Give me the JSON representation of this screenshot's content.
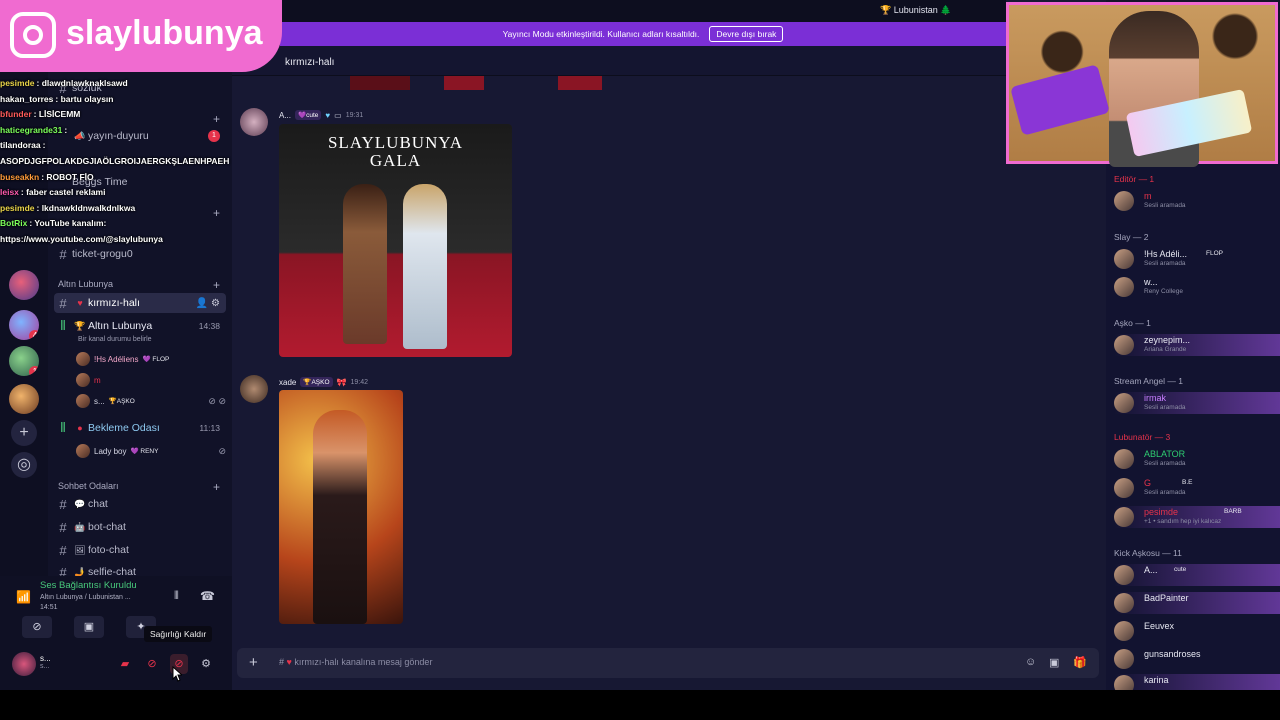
{
  "overlay": {
    "instagram_handle": "slaylubunya",
    "chat": [
      {
        "user": "pesimde",
        "color": "#e9d44a",
        "text": ": dlawdnlawknaklsawd"
      },
      {
        "user": "hakan_torres",
        "color": "#ffffff",
        "text": ": bartu olaysın"
      },
      {
        "user": "bfunder",
        "color": "#ff5b5b",
        "text": ": LİSİCEMM"
      },
      {
        "user": "haticegrande31",
        "color": "#7cff5b",
        "text": ":"
      },
      {
        "user": "tilandoraa",
        "color": "#ffffff",
        "text": ":"
      },
      {
        "user": "",
        "color": "#ffffff",
        "text": "ASOPDJGFPOLAKDGJIAÖLGROIJAERGKŞLAENHPAEH"
      },
      {
        "user": "buseakkn",
        "color": "#ff9b3a",
        "text": ": ROBOT FİO"
      },
      {
        "user": "leisx",
        "color": "#ff5bb0",
        "text": ": faber castel reklami"
      },
      {
        "user": "pesimde",
        "color": "#e9d44a",
        "text": ": lkdnawkldnwalkdnlkwa"
      },
      {
        "user": "BotRix",
        "color": "#7cff5b",
        "text": ": YouTube kanalım:"
      },
      {
        "user": "",
        "color": "#ffffff",
        "text": "https://www.youtube.com/@slaylubunya"
      }
    ]
  },
  "window": {
    "server_title": "Lubunistan",
    "notice_text": "Yayıncı Modu etkinleştirildi. Kullanıcı adları kısaltıldı.",
    "notice_button": "Devre dışı bırak"
  },
  "sidebar": {
    "partial_channels": [
      "sözlük",
      "yayın-duyuru",
      "Beggs Time",
      "ticket-grogu0"
    ],
    "cat_altin": "Altın Lubunya",
    "ch_kirmizi": "kırmızı-halı",
    "voice_altin": "Altın Lubunya",
    "voice_altin_time": "14:38",
    "voice_altin_note": "Bir kanal durumu belirle",
    "vu1_name": "!Hs Adéliens",
    "vu1_tag": "FLOP",
    "vu2_name": "m",
    "vu3_name": "s...",
    "vu3_tag": "AŞKO",
    "voice_bekleme": "Bekleme Odası",
    "voice_bekleme_time": "11:13",
    "vu4_name": "Lady boy",
    "vu4_tag": "RENY",
    "cat_sohbet": "Sohbet Odaları",
    "ch_chat": "chat",
    "ch_bot": "bot-chat",
    "ch_foto": "foto-chat",
    "ch_selfie": "selfie-chat",
    "badge_yayin": "1",
    "badge_s3": "4",
    "badge_s4": "1"
  },
  "voice_panel": {
    "status": "Ses Bağlantısı Kuruldu",
    "channel": "Altın Lubunya / Lubunistan ...",
    "time": "14:51",
    "user_name": "s...",
    "user_sub": "s...",
    "tooltip": "Sağırlığı Kaldır"
  },
  "chat": {
    "channel_name": "kırmızı-halı",
    "msg1_user": "A...",
    "msg1_badge": "cute",
    "msg1_time": "19:31",
    "msg1_image_caption": "SLAYLUBUNYA\nGALA",
    "msg2_user": "xade",
    "msg2_badge": "AŞKO",
    "msg2_time": "19:42",
    "composer_placeholder": "kırmızı-halı kanalına mesaj gönder"
  },
  "members": {
    "roles": [
      {
        "label": "Editör — 1",
        "color": "#e5334b"
      },
      {
        "label": "Slay — 2",
        "color": "#a5a6bd"
      },
      {
        "label": "Aşko — 1",
        "color": "#a5a6bd"
      },
      {
        "label": "Stream Angel — 1",
        "color": "#a5a6bd"
      },
      {
        "label": "Lubunatör — 3",
        "color": "#e5334b"
      },
      {
        "label": "Kick Aşkosu — 11",
        "color": "#a5a6bd"
      }
    ],
    "list": [
      {
        "name": "m",
        "status": "Sesli aramada",
        "color": "#e5334b"
      },
      {
        "name": "!Hs Adéli...",
        "status": "Sesli aramada",
        "color": "#e7e8f2",
        "tag": "FLOP"
      },
      {
        "name": "w...",
        "status": "Reny College",
        "color": "#e7e8f2"
      },
      {
        "name": "zeynepim...",
        "status": "Ariana Grande",
        "color": "#e7e8f2"
      },
      {
        "name": "irmak",
        "status": "Sesli aramada",
        "color": "#c77dff"
      },
      {
        "name": "ABLATOR",
        "status": "Sesli aramada",
        "color": "#2ecc71"
      },
      {
        "name": "G",
        "status": "Sesli aramada",
        "color": "#e5334b",
        "tag": "B.E"
      },
      {
        "name": "pesimde",
        "status": "+1 • sandım hep iyi kalıcaz",
        "color": "#e5334b",
        "tag": "BARB"
      },
      {
        "name": "A...",
        "status": "",
        "color": "#e7e8f2",
        "tag": "cute"
      },
      {
        "name": "BadPainter",
        "status": "",
        "color": "#e7e8f2"
      },
      {
        "name": "Eeuvex",
        "status": "",
        "color": "#e7e8f2"
      },
      {
        "name": "gunsandroses",
        "status": "",
        "color": "#e7e8f2"
      },
      {
        "name": "karina",
        "status": "",
        "color": "#e7e8f2"
      }
    ]
  }
}
